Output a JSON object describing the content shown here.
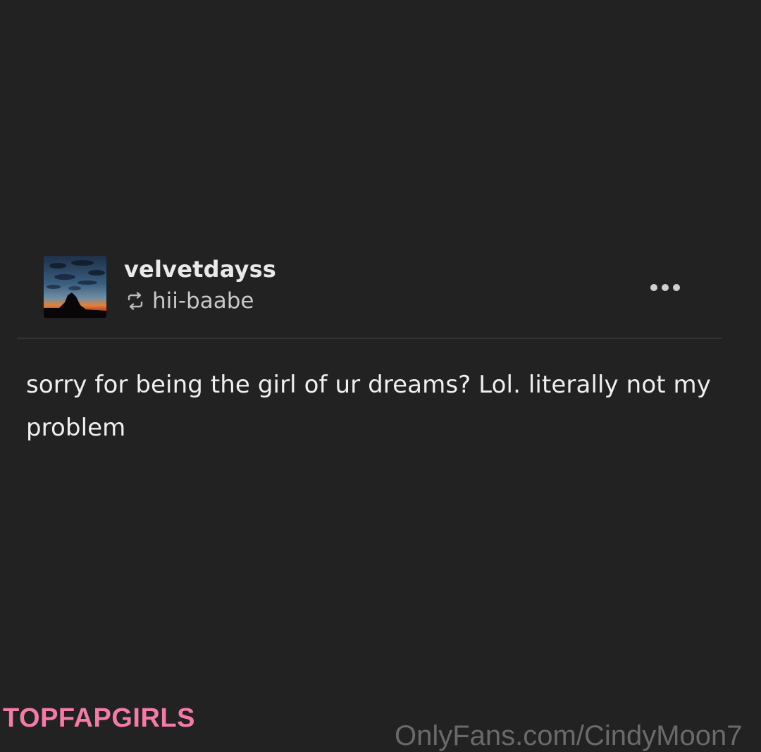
{
  "post": {
    "username": "velvetdayss",
    "reblogged_from": "hii-baabe",
    "body": "sorry for being the girl of ur dreams? Lol. literally not my problem",
    "avatar_icon": "avatar-sunset-sky",
    "reblog_icon": "reblog-icon",
    "more_icon": "more-options-icon"
  },
  "watermarks": {
    "logo_text": "TOPFAPGIRLS",
    "url_text": "OnlyFans.com/CindyMoon7"
  },
  "colors": {
    "background": "#222222",
    "text_primary": "#efefef",
    "text_secondary": "#c9c9c9",
    "logo_pink": "#f37ba8"
  }
}
